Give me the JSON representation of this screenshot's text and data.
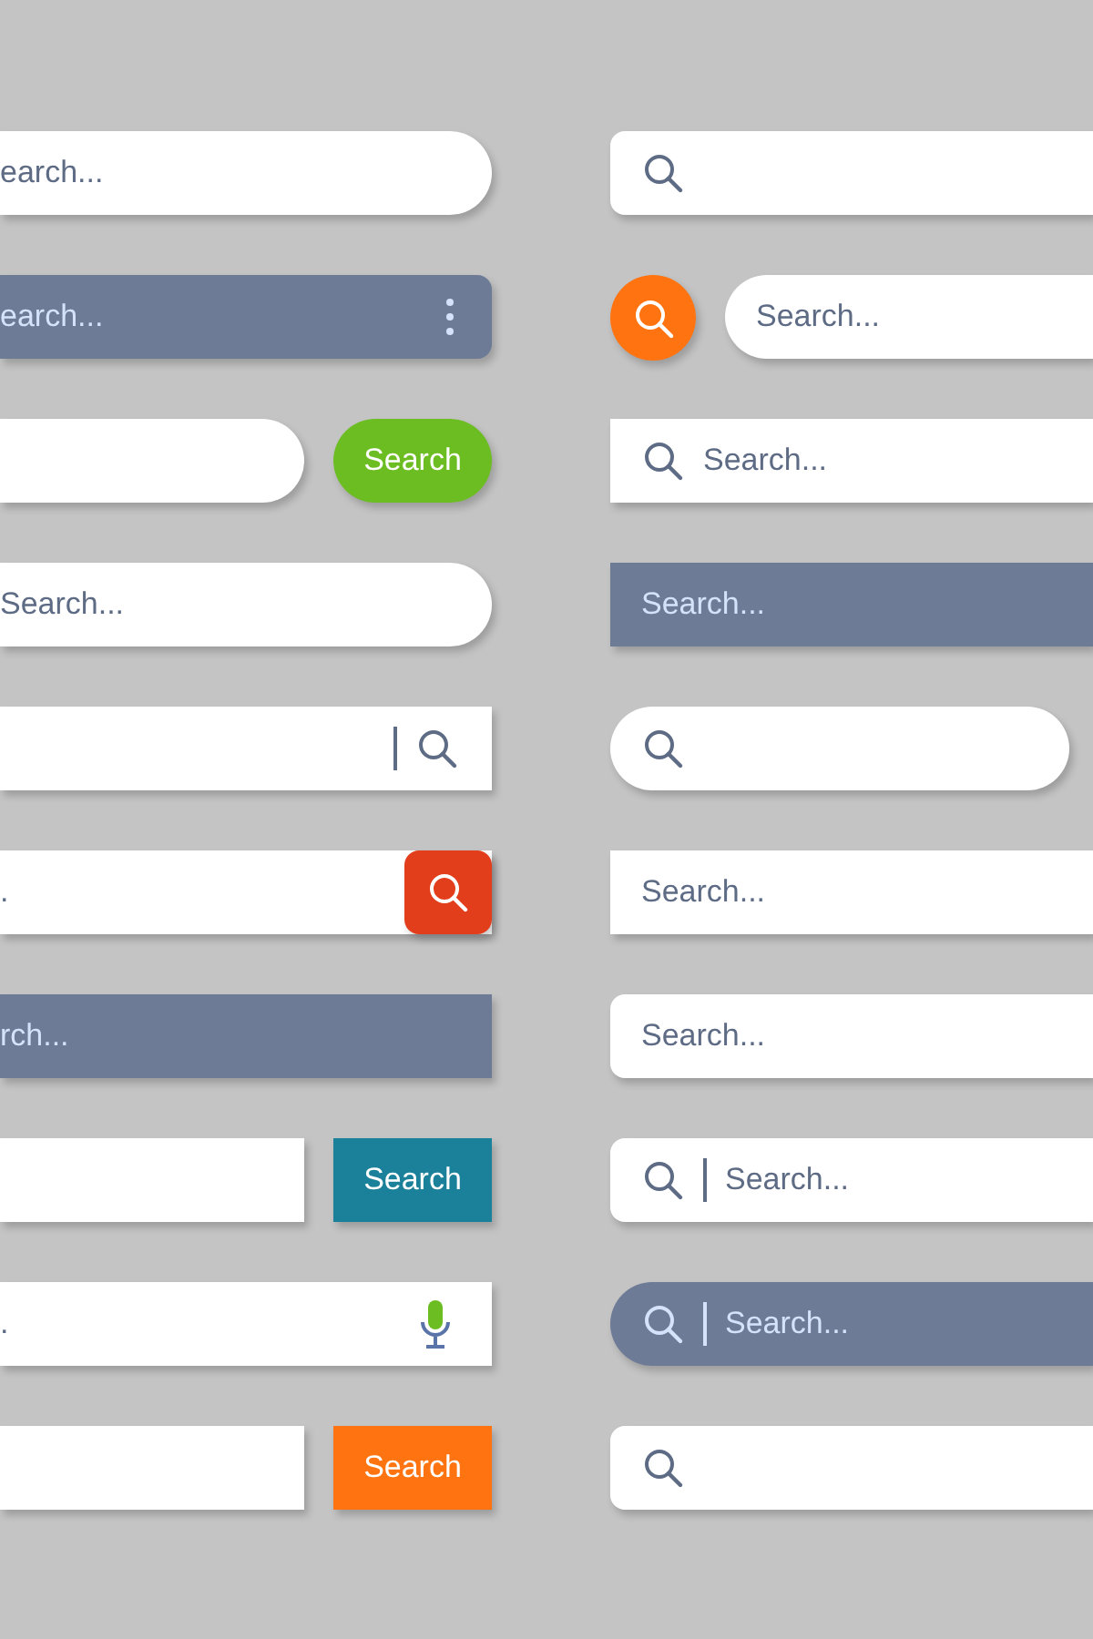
{
  "left_column": [
    {
      "field": {
        "kind": "pill",
        "dark": false,
        "placeholder": "earch..."
      }
    },
    {
      "field": {
        "kind": "rounded",
        "dark": true,
        "placeholder": "earch...",
        "trailing_icon": {
          "kind": "menu"
        }
      }
    },
    {
      "field": {
        "kind": "pill",
        "dark": false
      },
      "trailing_button": {
        "kind": "pill",
        "label": "Search",
        "color": "#6cbd22",
        "attached": false
      }
    },
    {
      "field": {
        "kind": "pill",
        "dark": false,
        "placeholder": "Search..."
      }
    },
    {
      "field": {
        "kind": "square",
        "dark": false,
        "cursor": true,
        "trailing_icon": {
          "kind": "search"
        }
      }
    },
    {
      "field": {
        "kind": "square",
        "dark": false,
        "placeholder": "."
      },
      "trailing_button": {
        "kind": "rounded",
        "color": "#e23e1c",
        "attached": true
      }
    },
    {
      "field": {
        "kind": "square",
        "dark": true,
        "placeholder": "rch..."
      }
    },
    {
      "field": {
        "kind": "square",
        "dark": false
      },
      "trailing_button": {
        "kind": "square",
        "label": "Search",
        "color": "#1b8099",
        "attached": false
      }
    },
    {
      "field": {
        "kind": "square",
        "dark": false,
        "placeholder": ".",
        "trailing_icon": {
          "kind": "mic"
        }
      }
    },
    {
      "field": {
        "kind": "square",
        "dark": false
      },
      "trailing_button": {
        "kind": "square",
        "label": "Search",
        "color": "#ff7410",
        "attached": false
      }
    }
  ],
  "right_column": [
    {
      "field": {
        "kind": "rounded",
        "dark": false,
        "leading_icon": {
          "kind": "search"
        }
      }
    },
    {
      "leading_button": {
        "kind": "circle",
        "color": "#ff7410"
      },
      "field": {
        "kind": "pill",
        "dark": false,
        "placeholder": "Search..."
      }
    },
    {
      "field": {
        "kind": "square",
        "dark": false,
        "leading_icon": {
          "kind": "search"
        },
        "placeholder": "Search..."
      }
    },
    {
      "field": {
        "kind": "square",
        "dark": true,
        "placeholder": "Search..."
      }
    },
    {
      "field": {
        "kind": "pill",
        "dark": false,
        "leading_icon": {
          "kind": "search"
        },
        "whole": true
      }
    },
    {
      "field": {
        "kind": "square",
        "dark": false,
        "placeholder": "Search..."
      }
    },
    {
      "field": {
        "kind": "rounded",
        "dark": false,
        "placeholder": "Search..."
      }
    },
    {
      "field": {
        "kind": "rounded",
        "dark": false,
        "leading_icon": {
          "kind": "search"
        },
        "cursor": true,
        "placeholder": "Search..."
      }
    },
    {
      "field": {
        "kind": "pill",
        "dark": true,
        "leading_icon": {
          "kind": "search"
        },
        "cursor": true,
        "placeholder": "Search..."
      }
    },
    {
      "field": {
        "kind": "rounded",
        "dark": false,
        "leading_icon": {
          "kind": "search"
        }
      }
    }
  ]
}
